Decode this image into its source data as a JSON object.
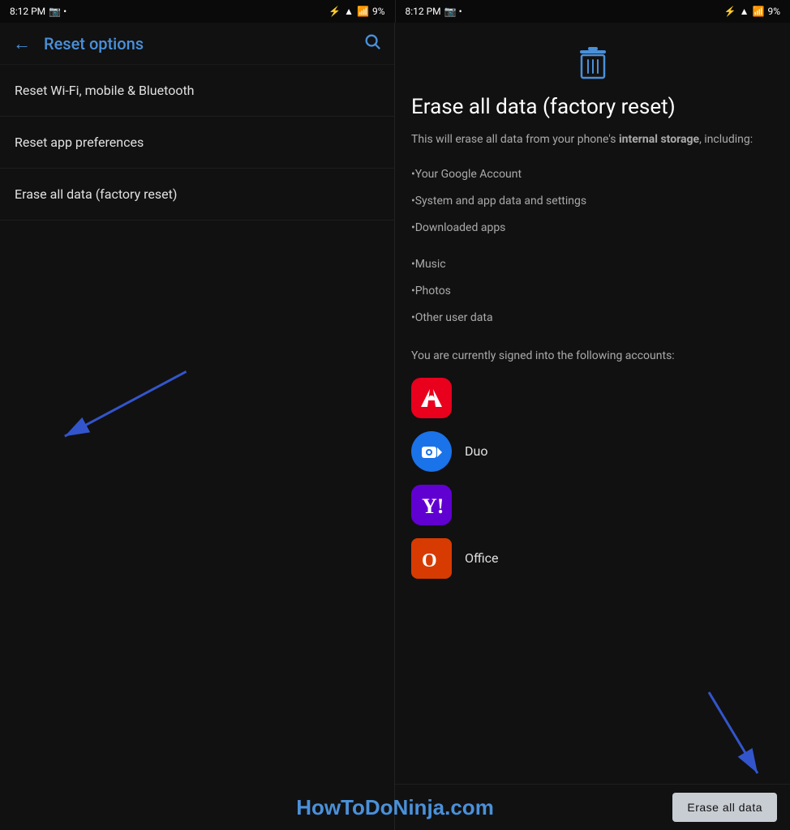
{
  "left_status_bar": {
    "time": "8:12 PM",
    "battery": "9%"
  },
  "right_status_bar": {
    "time": "8:12 PM",
    "battery": "9%"
  },
  "left_panel": {
    "header": {
      "title": "Reset options",
      "back_label": "←",
      "search_label": "🔍"
    },
    "menu_items": [
      {
        "label": "Reset Wi-Fi, mobile & Bluetooth"
      },
      {
        "label": "Reset app preferences"
      },
      {
        "label": "Erase all data (factory reset)"
      }
    ]
  },
  "right_panel": {
    "title": "Erase all data (factory reset)",
    "description_prefix": "This will erase all data from your phone's ",
    "description_bold": "internal storage",
    "description_suffix": ", including:",
    "bullet_items": [
      "•Your Google Account",
      "•System and app data and settings",
      "•Downloaded apps",
      "•Music",
      "•Photos",
      "•Other user data"
    ],
    "accounts_label": "You are currently signed into the following accounts:",
    "accounts": [
      {
        "name": "",
        "icon_type": "adobe",
        "label": ""
      },
      {
        "name": "Duo",
        "icon_type": "duo",
        "label": "Duo"
      },
      {
        "name": "Yahoo",
        "icon_type": "yahoo",
        "label": ""
      },
      {
        "name": "Office",
        "icon_type": "office",
        "label": "Office"
      }
    ],
    "erase_button": "Erase all data"
  },
  "watermark": "HowToDoNinja.com"
}
